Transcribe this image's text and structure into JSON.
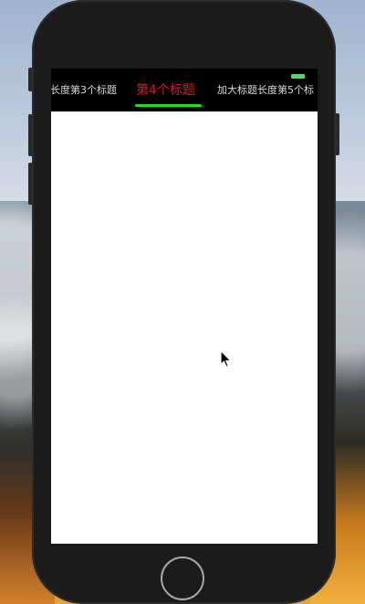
{
  "tabs": {
    "items": [
      {
        "label": "长度第3个标题",
        "selected": false
      },
      {
        "label": "第4个标题",
        "selected": true
      },
      {
        "label": "加大标题长度第5个标",
        "selected": false
      }
    ],
    "selected_color": "#e2161b",
    "unselected_color": "#d9d9d9",
    "indicator_color": "#29d62a"
  },
  "status": {
    "battery_icon": "battery-icon",
    "battery_color": "#4cd964"
  },
  "device": {
    "home_button_icon": "home-button-icon"
  },
  "pointer": {
    "icon": "mouse-cursor-icon"
  }
}
